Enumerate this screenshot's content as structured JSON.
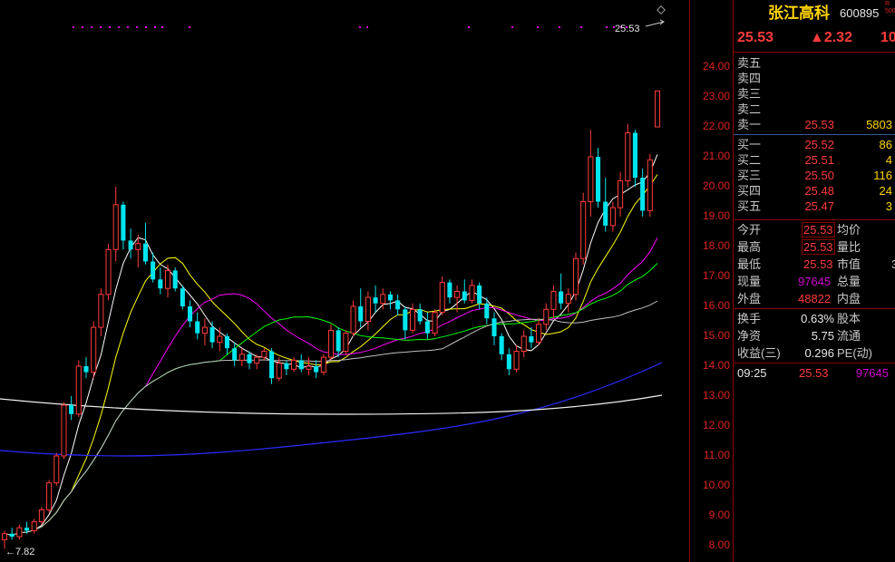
{
  "stock": {
    "name": "张江高科",
    "code": "600895",
    "badge_top": "R",
    "badge_bottom": "500",
    "price": "25.53",
    "change": "▲2.32",
    "pct_partial": "10"
  },
  "chart_overlay": {
    "last_price_label": "25.53",
    "low_label": "←7.82"
  },
  "price_axis": {
    "ticks": [
      "24.00",
      "23.00",
      "22.00",
      "21.00",
      "20.00",
      "19.00",
      "18.00",
      "17.00",
      "16.00",
      "15.00",
      "14.00",
      "13.00",
      "12.00",
      "11.00",
      "10.00",
      "9.00",
      "8.00"
    ]
  },
  "order_book": {
    "asks": [
      {
        "label": "卖五",
        "price": "",
        "vol": ""
      },
      {
        "label": "卖四",
        "price": "",
        "vol": ""
      },
      {
        "label": "卖三",
        "price": "",
        "vol": ""
      },
      {
        "label": "卖二",
        "price": "",
        "vol": ""
      },
      {
        "label": "卖一",
        "price": "25.53",
        "vol": "5803"
      }
    ],
    "bids": [
      {
        "label": "买一",
        "price": "25.52",
        "vol": "86"
      },
      {
        "label": "买二",
        "price": "25.51",
        "vol": "4"
      },
      {
        "label": "买三",
        "price": "25.50",
        "vol": "116"
      },
      {
        "label": "买四",
        "price": "25.48",
        "vol": "24"
      },
      {
        "label": "买五",
        "price": "25.47",
        "vol": "3"
      }
    ]
  },
  "quote": {
    "open_label": "今开",
    "open": "25.53",
    "avg_label": "均价",
    "high_label": "最高",
    "high": "25.53",
    "vol_ratio_label": "量比",
    "low_label": "最低",
    "low": "25.53",
    "mktcap_label": "市值",
    "mktcap_partial": "3",
    "cur_vol_label": "现量",
    "cur_vol": "97645",
    "total_vol_label": "总量",
    "outer_label": "外盘",
    "outer": "48822",
    "inner_label": "内盘"
  },
  "fundamentals": {
    "turnover_label": "换手",
    "turnover": "0.63%",
    "share_label": "股本",
    "nav_label": "净资",
    "nav": "5.75",
    "float_label": "流通",
    "eps_label": "收益(三)",
    "eps": "0.296",
    "pe_label": "PE(动)"
  },
  "tick": {
    "time": "09:25",
    "price": "25.53",
    "vol": "97645"
  },
  "chart_data": {
    "type": "candlestick",
    "ylim": [
      7.6,
      25.6
    ],
    "last": 25.53,
    "period_low": 7.82,
    "candles": [
      [
        8.2,
        8.5,
        7.9,
        8.4
      ],
      [
        8.4,
        8.6,
        8.2,
        8.3
      ],
      [
        8.3,
        8.7,
        8.2,
        8.6
      ],
      [
        8.6,
        8.8,
        8.4,
        8.5
      ],
      [
        8.5,
        8.9,
        8.4,
        8.8
      ],
      [
        8.8,
        9.3,
        8.7,
        9.2
      ],
      [
        9.2,
        10.2,
        9.1,
        10.1
      ],
      [
        10.1,
        11.1,
        10.0,
        11.0
      ],
      [
        11.0,
        12.8,
        10.9,
        12.7
      ],
      [
        12.7,
        13.0,
        12.2,
        12.4
      ],
      [
        12.4,
        14.2,
        12.3,
        14.0
      ],
      [
        14.0,
        14.3,
        13.6,
        13.8
      ],
      [
        13.8,
        15.5,
        13.6,
        15.3
      ],
      [
        15.3,
        16.6,
        15.0,
        16.4
      ],
      [
        16.4,
        18.1,
        16.2,
        17.9
      ],
      [
        17.9,
        20.0,
        17.5,
        19.4
      ],
      [
        19.4,
        19.5,
        17.9,
        18.2
      ],
      [
        18.2,
        18.6,
        17.6,
        17.9
      ],
      [
        17.9,
        18.4,
        17.3,
        18.1
      ],
      [
        18.1,
        18.8,
        17.4,
        17.5
      ],
      [
        17.5,
        17.8,
        16.8,
        16.9
      ],
      [
        16.9,
        17.3,
        16.4,
        16.6
      ],
      [
        16.6,
        17.4,
        16.3,
        17.2
      ],
      [
        17.2,
        17.3,
        16.5,
        16.6
      ],
      [
        16.6,
        16.7,
        15.9,
        16.0
      ],
      [
        16.0,
        16.2,
        15.3,
        15.5
      ],
      [
        15.5,
        15.8,
        14.9,
        15.1
      ],
      [
        15.1,
        15.6,
        14.7,
        15.3
      ],
      [
        15.3,
        15.5,
        14.6,
        14.8
      ],
      [
        14.8,
        15.3,
        14.5,
        15.0
      ],
      [
        15.0,
        15.1,
        14.4,
        14.6
      ],
      [
        14.6,
        14.8,
        14.0,
        14.2
      ],
      [
        14.2,
        14.6,
        14.0,
        14.4
      ],
      [
        14.4,
        14.5,
        13.9,
        14.1
      ],
      [
        14.1,
        14.4,
        13.9,
        14.3
      ],
      [
        14.3,
        14.6,
        14.2,
        14.5
      ],
      [
        14.5,
        14.6,
        13.4,
        13.6
      ],
      [
        13.6,
        14.3,
        13.5,
        14.1
      ],
      [
        14.1,
        14.2,
        13.7,
        13.9
      ],
      [
        13.9,
        14.3,
        13.8,
        14.2
      ],
      [
        14.2,
        14.4,
        13.8,
        13.9
      ],
      [
        13.9,
        14.3,
        13.7,
        14.0
      ],
      [
        14.0,
        14.2,
        13.6,
        13.8
      ],
      [
        13.8,
        14.4,
        13.7,
        14.3
      ],
      [
        14.3,
        15.4,
        14.2,
        15.2
      ],
      [
        15.2,
        15.3,
        14.3,
        14.5
      ],
      [
        14.5,
        15.2,
        14.4,
        15.1
      ],
      [
        15.1,
        16.2,
        15.0,
        16.0
      ],
      [
        16.0,
        16.6,
        15.3,
        15.5
      ],
      [
        15.5,
        16.5,
        15.2,
        16.3
      ],
      [
        16.3,
        16.7,
        15.8,
        16.1
      ],
      [
        16.1,
        16.6,
        15.9,
        16.4
      ],
      [
        16.4,
        16.5,
        15.9,
        16.2
      ],
      [
        16.2,
        16.4,
        15.7,
        15.9
      ],
      [
        15.9,
        16.0,
        14.9,
        15.2
      ],
      [
        15.2,
        16.1,
        15.1,
        15.9
      ],
      [
        15.9,
        16.1,
        15.4,
        15.5
      ],
      [
        15.5,
        15.8,
        14.9,
        15.1
      ],
      [
        15.1,
        15.9,
        15.0,
        15.8
      ],
      [
        15.8,
        17.0,
        15.7,
        16.8
      ],
      [
        16.8,
        16.9,
        16.1,
        16.3
      ],
      [
        16.3,
        16.7,
        15.8,
        16.5
      ],
      [
        16.5,
        16.9,
        16.1,
        16.2
      ],
      [
        16.2,
        16.9,
        16.1,
        16.7
      ],
      [
        16.7,
        16.8,
        15.9,
        16.1
      ],
      [
        16.1,
        16.3,
        15.4,
        15.6
      ],
      [
        15.6,
        15.8,
        14.7,
        15.0
      ],
      [
        15.0,
        15.1,
        14.2,
        14.4
      ],
      [
        14.4,
        14.6,
        13.7,
        13.9
      ],
      [
        13.9,
        14.7,
        13.8,
        14.5
      ],
      [
        14.5,
        15.2,
        14.3,
        15.0
      ],
      [
        15.0,
        15.3,
        14.6,
        14.8
      ],
      [
        14.8,
        15.6,
        14.7,
        15.4
      ],
      [
        15.4,
        16.1,
        15.2,
        15.9
      ],
      [
        15.9,
        16.7,
        15.6,
        16.5
      ],
      [
        16.5,
        17.1,
        15.9,
        16.1
      ],
      [
        16.1,
        16.6,
        15.8,
        16.4
      ],
      [
        16.4,
        17.8,
        16.2,
        17.6
      ],
      [
        17.6,
        19.8,
        17.4,
        19.5
      ],
      [
        19.5,
        21.9,
        19.0,
        21.0
      ],
      [
        21.0,
        21.3,
        19.3,
        19.5
      ],
      [
        19.5,
        20.3,
        18.5,
        18.7
      ],
      [
        18.7,
        19.5,
        18.5,
        19.3
      ],
      [
        19.3,
        20.5,
        19.0,
        20.2
      ],
      [
        20.2,
        22.1,
        20.0,
        21.8
      ],
      [
        21.8,
        21.9,
        20.0,
        20.3
      ],
      [
        20.3,
        20.6,
        19.0,
        19.2
      ],
      [
        19.2,
        21.1,
        19.0,
        20.9
      ],
      [
        22.0,
        23.2,
        22.0,
        23.2
      ]
    ]
  }
}
